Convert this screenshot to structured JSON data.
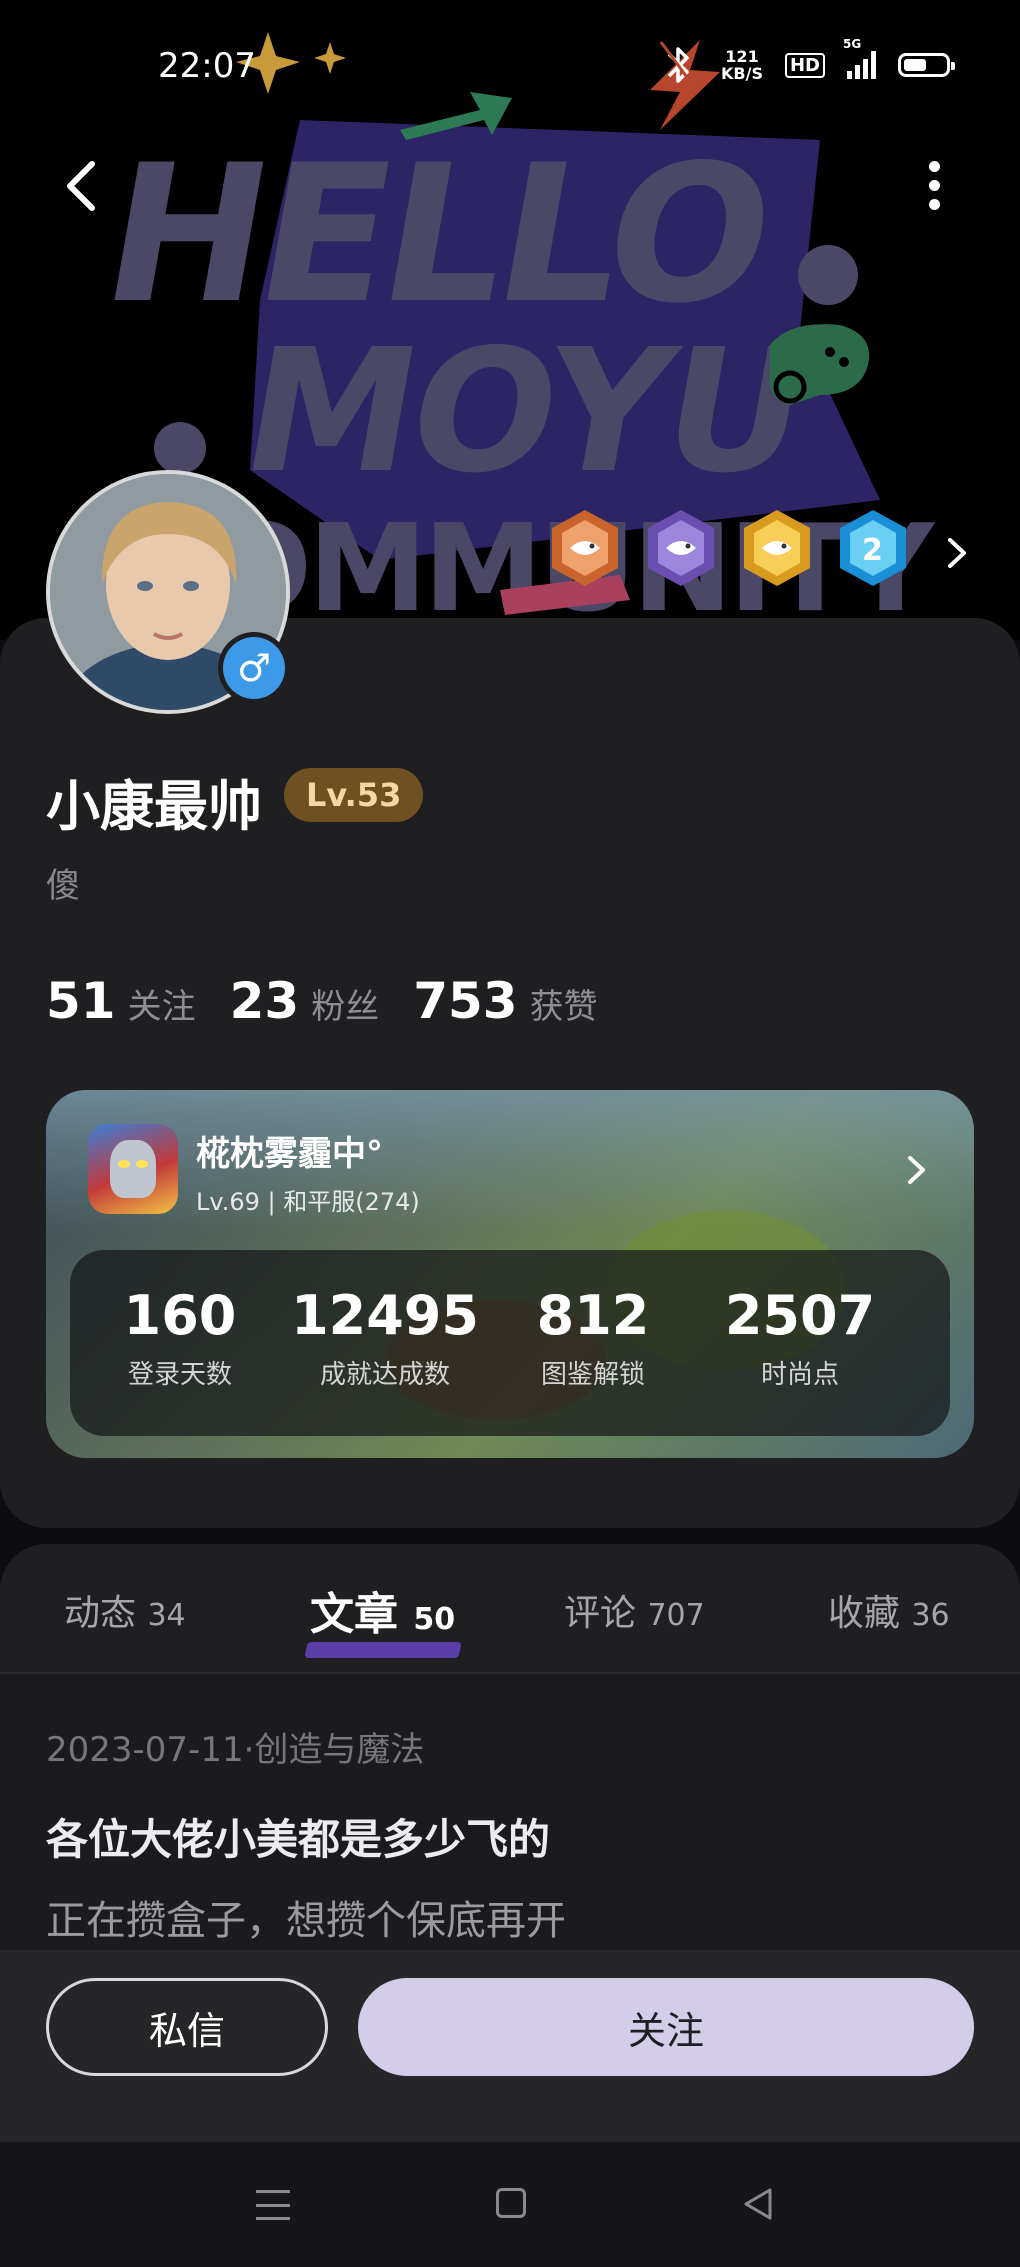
{
  "status_bar": {
    "time": "22:07",
    "net_speed_value": "121",
    "net_speed_unit": "KB/S",
    "hd_label": "HD",
    "signal_label": "5G",
    "battery_level": 0.55,
    "bluetooth_icon": "bluetooth-icon"
  },
  "header": {
    "back_icon": "chevron-left-icon",
    "more_icon": "more-vertical-icon",
    "banner_logo_lines": [
      "HELLO",
      "MOYU",
      "COMMUNITY"
    ]
  },
  "badges": {
    "count": 4,
    "icons": [
      "fish-badge-bronze-icon",
      "fish-badge-purple-icon",
      "fish-badge-gold-icon",
      "fish-badge-blue-icon"
    ],
    "more_icon": "chevron-right-icon"
  },
  "profile": {
    "username": "小康最帅",
    "level": "Lv.53",
    "bio": "傻",
    "gender_icon": "male-icon",
    "gender_symbol": "♂",
    "stats": [
      {
        "value": "51",
        "label": "关注"
      },
      {
        "value": "23",
        "label": "粉丝"
      },
      {
        "value": "753",
        "label": "获赞"
      }
    ]
  },
  "game_card": {
    "name": "椛枕雾霾中°",
    "subtitle": "Lv.69 | 和平服(274)",
    "stats": [
      {
        "value": "160",
        "label": "登录天数"
      },
      {
        "value": "12495",
        "label": "成就达成数"
      },
      {
        "value": "812",
        "label": "图鉴解锁"
      },
      {
        "value": "2507",
        "label": "时尚点"
      }
    ]
  },
  "tabs": [
    {
      "label": "动态",
      "count": "34"
    },
    {
      "label": "文章",
      "count": "50"
    },
    {
      "label": "评论",
      "count": "707"
    },
    {
      "label": "收藏",
      "count": "36"
    }
  ],
  "active_tab": "文章",
  "post": {
    "meta": "2023-07-11·创造与魔法",
    "title": "各位大佬小美都是多少飞的",
    "body": "正在攒盒子，想攒个保底再开"
  },
  "actions": {
    "message_label": "私信",
    "follow_label": "关注"
  },
  "colors": {
    "accent_purple": "#5a3fa8",
    "follow_button": "#d3cdea",
    "level_pill": "#6e5021",
    "gender_blue": "#3d9ae8"
  }
}
